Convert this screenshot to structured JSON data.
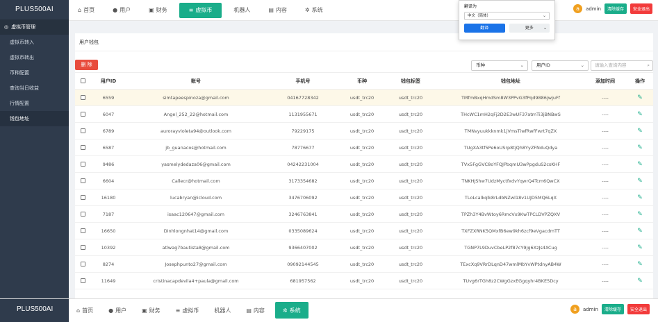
{
  "brand": "PLUS500AI",
  "sidebar": {
    "group": "虚拟币管理",
    "items": [
      {
        "label": "虚拟币转入"
      },
      {
        "label": "虚拟币转出"
      },
      {
        "label": "币种配置"
      },
      {
        "label": "查询当日收益"
      },
      {
        "label": "行情配置"
      },
      {
        "label": "钱包地址"
      }
    ]
  },
  "topnav": {
    "items": [
      {
        "label": "首页",
        "icon": "home-icon"
      },
      {
        "label": "用户",
        "icon": "user-icon"
      },
      {
        "label": "财务",
        "icon": "briefcase-icon"
      },
      {
        "label": "虚拟币",
        "icon": "coins-icon"
      },
      {
        "label": "机器人",
        "icon": ""
      },
      {
        "label": "内容",
        "icon": "document-icon"
      },
      {
        "label": "系统",
        "icon": "gear-icon"
      }
    ],
    "active_index": 3,
    "avatar_letter": "a",
    "user": "admin",
    "clear_cache": "清除缓存",
    "logout": "安全退出"
  },
  "translate": {
    "title": "翻译为",
    "language": "中文（简体）",
    "translate_btn": "翻译",
    "more_btn": "更多"
  },
  "panel": {
    "title": "用户钱包",
    "delete_btn": "删 除",
    "currency_select": "币种",
    "field_select": "用户ID",
    "search_placeholder": "请输入查询内容"
  },
  "table": {
    "headers": [
      "用户ID",
      "账号",
      "手机号",
      "币种",
      "钱包标签",
      "钱包地址",
      "添加时间",
      "操作"
    ],
    "rows": [
      {
        "id": "6559",
        "account": "simtapeespinoza@gmail.com",
        "phone": "04167728342",
        "coin": "usdt_trc20",
        "tag": "usdt_trc20",
        "address": "TMfmBxqHmdSm8W3PPvG3fPqd9886jwjuFf",
        "time": "----"
      },
      {
        "id": "6047",
        "account": "Angel_252_22@hotmail.com",
        "phone": "1131955671",
        "coin": "usdt_trc20",
        "tag": "usdt_trc20",
        "address": "THcWC1mH2qFj2D2E3wUF37atmTi3jBNBwS",
        "time": "----"
      },
      {
        "id": "6789",
        "account": "aurorayvioleta94@outlook.com",
        "phone": "79229175",
        "coin": "usdt_trc20",
        "tag": "usdt_trc20",
        "address": "TMNvyuukkknmk1jVmsTiwfRwfFwrt7qZX",
        "time": "----"
      },
      {
        "id": "6587",
        "account": "jb_guanacos@hotmail.com",
        "phone": "78776677",
        "coin": "usdt_trc20",
        "tag": "usdt_trc20",
        "address": "TUgXA3tf5Pe6oUSrp8tjQh8YyZFNduQdya",
        "time": "----"
      },
      {
        "id": "9486",
        "account": "yasmelydedaza06@gmail.com",
        "phone": "04242231004",
        "coin": "usdt_trc20",
        "tag": "usdt_trc20",
        "address": "TVx5FgGVC8oYFQJPbqmU3wPpgduS2csKHF",
        "time": "----"
      },
      {
        "id": "6604",
        "account": "Callecr@hotmail.com",
        "phone": "3173354682",
        "coin": "usdt_trc20",
        "tag": "usdt_trc20",
        "address": "TNKHJShw7UdzMyctfxdvYqwrQ4Tcm6QwCX",
        "time": "----"
      },
      {
        "id": "16180",
        "account": "lucabryan@icloud.com",
        "phone": "3476706092",
        "coin": "usdt_trc20",
        "tag": "usdt_trc20",
        "address": "TLoLcalkqlk8rLdbNZwl18v1UJD5MQ6LqX",
        "time": "----"
      },
      {
        "id": "7187",
        "account": "isaac120647@gmail.com",
        "phone": "3246763841",
        "coin": "usdt_trc20",
        "tag": "usdt_trc20",
        "address": "TPZh3Y4BvWtoy6RmcVx9KwTPCLDVPZQXV",
        "time": "----"
      },
      {
        "id": "16650",
        "account": "Dinhlongnhat14@gmail.com",
        "phone": "0335089624",
        "coin": "usdt_trc20",
        "tag": "usdt_trc20",
        "address": "TXFZXRNK5QMxfB6ew9kh6zcf9eVgacdmTT",
        "time": "----"
      },
      {
        "id": "10392",
        "account": "atlwag7bautista8@gmail.com",
        "phone": "9366407002",
        "coin": "usdt_trc20",
        "tag": "usdt_trc20",
        "address": "TGNP7L9DuvCbeLP2f87cY9Jg6XzJs4XCug",
        "time": "----"
      },
      {
        "id": "8274",
        "account": "Josephpunto27@gmail.com",
        "phone": "09092144545",
        "coin": "usdt_trc20",
        "tag": "usdt_trc20",
        "address": "TExcXq9VRrDLqnD47wmlMbYvWPtdnyAB4W",
        "time": "----"
      },
      {
        "id": "11649",
        "account": "cristinacapdevila4+paula@gmail.com",
        "phone": "681957562",
        "coin": "usdt_trc20",
        "tag": "usdt_trc20",
        "address": "TUvg6rTGh8z2CWgGzxEGgqyhr4BKE5Dcy",
        "time": "----"
      }
    ],
    "highlight_row": 0
  },
  "colors": {
    "sidebar_bg": "#2f3b4c",
    "accent_green": "#1aad8a",
    "danger_red": "#e84c3d",
    "avatar_orange": "#f0a020",
    "translate_blue": "#1a73e8"
  }
}
